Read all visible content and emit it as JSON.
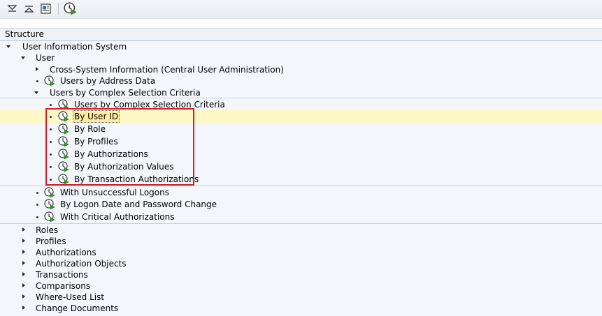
{
  "toolbar": {
    "buttons": [
      {
        "name": "expand-all",
        "icon": "expand-all-icon"
      },
      {
        "name": "collapse-all",
        "icon": "collapse-all-icon"
      },
      {
        "name": "documentation",
        "icon": "documentation-icon"
      },
      {
        "name": "execute",
        "icon": "execute-icon"
      }
    ]
  },
  "tree": {
    "header": "Structure",
    "root": "User Information System",
    "user": {
      "label": "User",
      "items": {
        "cross_system": "Cross-System Information (Central User Administration)",
        "by_address": "Users by Address Data",
        "complex_folder": "Users by Complex Selection Criteria",
        "complex": [
          "Users by Complex Selection Criteria",
          "By User ID",
          "By Role",
          "By Profiles",
          "By Authorizations",
          "By Authorization Values",
          "By Transaction Authorizations"
        ],
        "unsuccessful": "With Unsuccessful Logons",
        "logon_date": "By Logon Date and Password Change",
        "critical": "With Critical Authorizations"
      }
    },
    "other_nodes": [
      "Roles",
      "Profiles",
      "Authorizations",
      "Authorization Objects",
      "Transactions",
      "Comparisons",
      "Where-Used List",
      "Change Documents"
    ],
    "selected_item": "By User ID",
    "highlight_color": "#d0202a",
    "selection_color": "#fdf8c6"
  }
}
